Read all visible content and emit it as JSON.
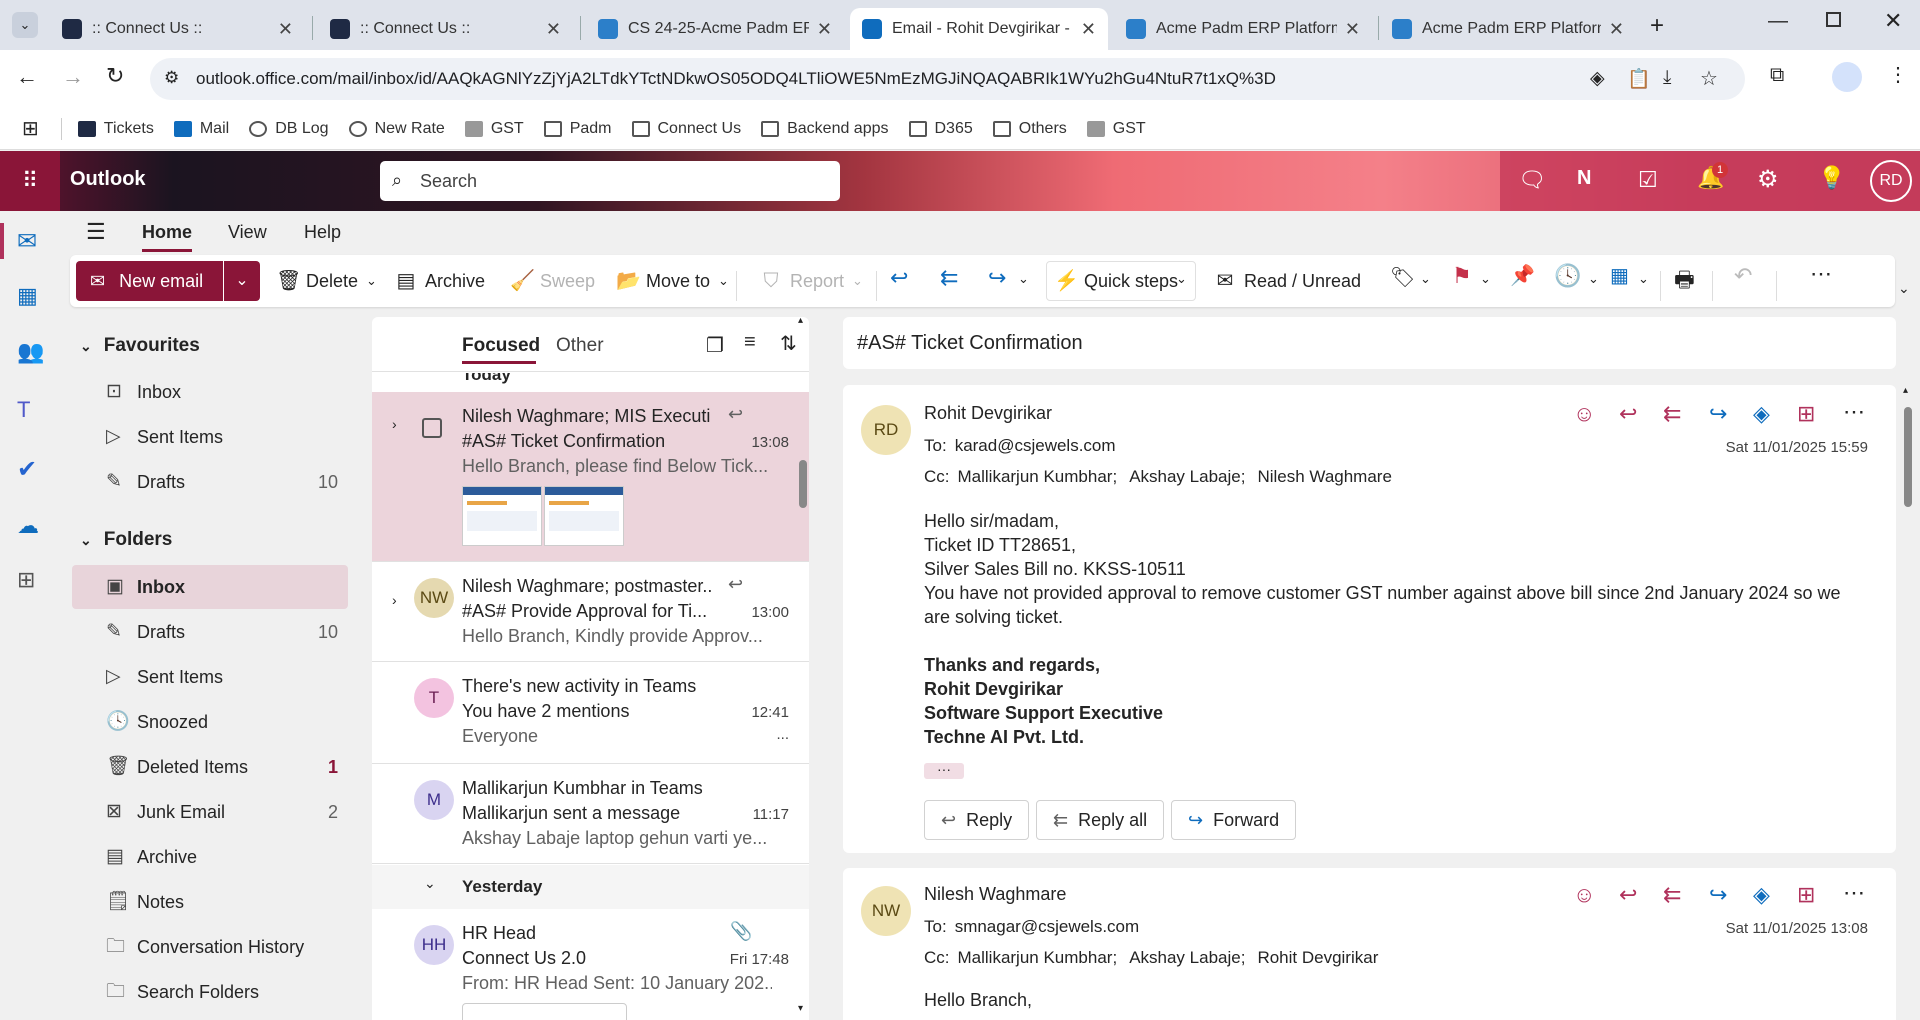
{
  "browser": {
    "tabs": [
      {
        "title": ":: Connect Us ::"
      },
      {
        "title": ":: Connect Us ::"
      },
      {
        "title": "CS 24-25-Acme Padm ERP"
      },
      {
        "title": "Email - Rohit Devgirikar - O"
      },
      {
        "title": "Acme Padm ERP Platform"
      },
      {
        "title": "Acme Padm ERP Platform"
      }
    ],
    "url": "outlook.office.com/mail/inbox/id/AAQkAGNlYzZjYjA2LTdkYTctNDkwOS05ODQ4LTliOWE5NmEzMGJiNQAQABRIk1WYu2hGu4NtuR7t1xQ%3D",
    "bookmarks": [
      "Tickets",
      "Mail",
      "DB Log",
      "New Rate",
      "GST",
      "Padm",
      "Connect Us",
      "Backend apps",
      "D365",
      "Others",
      "GST"
    ]
  },
  "outlook": {
    "app_name": "Outlook",
    "search_placeholder": "Search",
    "notification_count": "1",
    "user_initials": "RD",
    "brand_color": "#8a1538"
  },
  "ribbon": {
    "tabs": [
      "Home",
      "View",
      "Help"
    ],
    "new_email": "New email",
    "delete": "Delete",
    "archive": "Archive",
    "sweep": "Sweep",
    "move_to": "Move to",
    "report": "Report",
    "quick_steps": "Quick steps",
    "read_unread": "Read / Unread"
  },
  "folders": {
    "favourites_label": "Favourites",
    "favourites": [
      {
        "label": "Inbox",
        "count": ""
      },
      {
        "label": "Sent Items",
        "count": ""
      },
      {
        "label": "Drafts",
        "count": "10"
      }
    ],
    "folders_label": "Folders",
    "items": [
      {
        "label": "Inbox",
        "count": ""
      },
      {
        "label": "Drafts",
        "count": "10"
      },
      {
        "label": "Sent Items",
        "count": ""
      },
      {
        "label": "Snoozed",
        "count": ""
      },
      {
        "label": "Deleted Items",
        "count": "1"
      },
      {
        "label": "Junk Email",
        "count": "2"
      },
      {
        "label": "Archive",
        "count": ""
      },
      {
        "label": "Notes",
        "count": ""
      },
      {
        "label": "Conversation History",
        "count": ""
      },
      {
        "label": "Search Folders",
        "count": ""
      }
    ]
  },
  "message_list": {
    "focused": "Focused",
    "other": "Other",
    "group_today": "Today",
    "group_yesterday": "Yesterday",
    "messages": [
      {
        "from": "Nilesh Waghmare; MIS Executi...",
        "subject": "#AS# Ticket Confirmation",
        "time": "13:08",
        "preview": "Hello Branch, please find Below Tick...",
        "initials": ""
      },
      {
        "from": "Nilesh Waghmare; postmaster...",
        "subject": "#AS# Provide Approval for Ti...",
        "time": "13:00",
        "preview": "Hello Branch, Kindly provide Approv...",
        "initials": "NW"
      },
      {
        "from": "There's new activity in Teams",
        "subject": "You have 2 mentions",
        "time": "12:41",
        "preview": "Everyone",
        "extra": "...",
        "initials": "T"
      },
      {
        "from": "Mallikarjun Kumbhar in Teams",
        "subject": "Mallikarjun sent a message",
        "time": "11:17",
        "preview": "Akshay Labaje laptop gehun varti ye...",
        "initials": "M"
      },
      {
        "from": "HR Head",
        "subject": "Connect Us 2.0",
        "time": "Fri 17:48",
        "preview": "From: HR Head Sent: 10 January 202...",
        "initials": "HH"
      }
    ]
  },
  "reading": {
    "subject": "#AS# Ticket Confirmation",
    "msg1": {
      "initials": "RD",
      "from": "Rohit Devgirikar",
      "to_label": "To:",
      "to": "karad@csjewels.com",
      "date": "Sat 11/01/2025 15:59",
      "cc_label": "Cc:",
      "cc": [
        "Mallikarjun Kumbhar;",
        "Akshay Labaje;",
        "Nilesh Waghmare"
      ],
      "body": [
        "Hello sir/madam,",
        "Ticket ID TT28651,",
        "Silver Sales Bill no. KKSS-10511",
        "You have not provided approval to remove customer GST number against above bill since 2nd January 2024 so we are solving ticket."
      ],
      "signature": [
        "Thanks and regards,",
        "Rohit Devgirikar",
        "Software Support Executive",
        "Techne AI Pvt. Ltd."
      ],
      "more": "···",
      "reply": "Reply",
      "reply_all": "Reply all",
      "forward": "Forward"
    },
    "msg2": {
      "initials": "NW",
      "from": "Nilesh Waghmare",
      "to_label": "To:",
      "to": "smnagar@csjewels.com",
      "date": "Sat 11/01/2025 13:08",
      "cc_label": "Cc:",
      "cc": [
        "Mallikarjun Kumbhar;",
        "Akshay Labaje;",
        "Rohit Devgirikar"
      ],
      "body_first": "Hello Branch,"
    }
  }
}
